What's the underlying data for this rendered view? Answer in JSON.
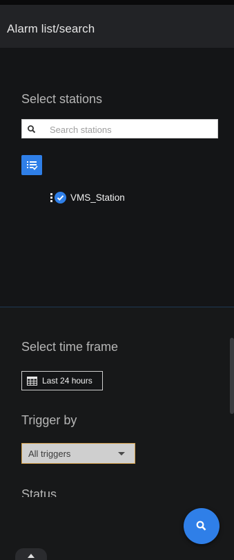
{
  "header": {
    "title": "Alarm list/search"
  },
  "stations": {
    "section_title": "Select stations",
    "search_placeholder": "Search stations",
    "search_value": "",
    "list_toggle_icon": "list-check-icon",
    "items": [
      {
        "label": "VMS_Station",
        "checked": true
      }
    ]
  },
  "time_frame": {
    "section_title": "Select time frame",
    "button_label": "Last 24 hours",
    "icon": "calendar-grid-icon"
  },
  "trigger": {
    "section_title": "Trigger by",
    "selected": "All triggers"
  },
  "status": {
    "section_title": "Status"
  },
  "fab": {
    "icon": "search-icon"
  },
  "colors": {
    "accent": "#2f7fe8",
    "background": "#141517",
    "header": "#222326",
    "select_border": "#d4a04a"
  }
}
